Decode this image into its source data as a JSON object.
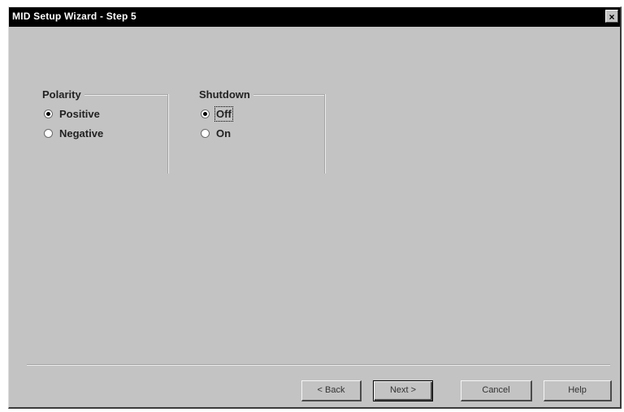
{
  "window": {
    "title": "MID Setup Wizard - Step 5",
    "close_label": "×"
  },
  "polarity": {
    "label": "Polarity",
    "options": [
      {
        "label": "Positive",
        "selected": true
      },
      {
        "label": "Negative",
        "selected": false
      }
    ]
  },
  "shutdown": {
    "label": "Shutdown",
    "options": [
      {
        "label": "Off",
        "selected": true
      },
      {
        "label": "On",
        "selected": false
      }
    ]
  },
  "buttons": {
    "back": "< Back",
    "next": "Next >",
    "cancel": "Cancel",
    "help": "Help"
  }
}
